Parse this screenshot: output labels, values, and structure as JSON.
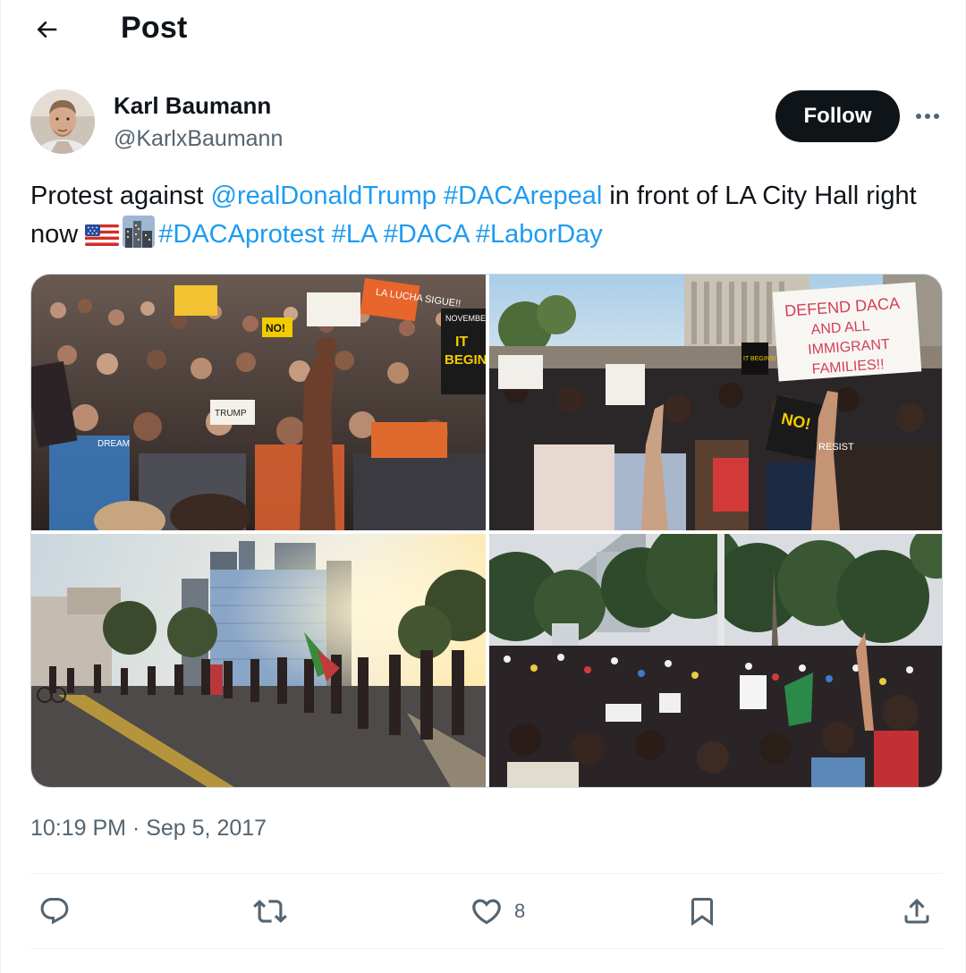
{
  "header": {
    "title": "Post",
    "back_icon": "arrow-left-icon"
  },
  "author": {
    "name": "Karl Baumann",
    "handle": "@KarlxBaumann",
    "follow_label": "Follow"
  },
  "tweet": {
    "segments": [
      {
        "text": "Protest against ",
        "type": "text"
      },
      {
        "text": "@realDonaldTrump",
        "type": "link"
      },
      {
        "text": " ",
        "type": "text"
      },
      {
        "text": "#DACArepeal",
        "type": "link"
      },
      {
        "text": " in front of LA City Hall right now ",
        "type": "text"
      },
      {
        "text": "#DACAprotest",
        "type": "link"
      },
      {
        "text": " ",
        "type": "text"
      },
      {
        "text": "#LA",
        "type": "link"
      },
      {
        "text": " ",
        "type": "text"
      },
      {
        "text": "#DACA",
        "type": "link"
      },
      {
        "text": " ",
        "type": "text"
      },
      {
        "text": "#LaborDay",
        "type": "link"
      }
    ],
    "emojis": [
      "us-flag-emoji",
      "cityscape-emoji"
    ],
    "link_color": "#1d9bf0"
  },
  "photos": {
    "p1": {
      "signs": [
        "LA LUCHA SIGUE!!",
        "NOVEMBER",
        "IT",
        "BEGIN",
        "NO!",
        "TRUMP",
        "DREAM"
      ]
    },
    "p2": {
      "signs": [
        "DEFEND DACA",
        "AND ALL",
        "IMMIGRANT",
        "FAMILIES!!",
        "NO!",
        "IT BEGINS!",
        "RESIST"
      ]
    },
    "p3": {},
    "p4": {}
  },
  "timestamp": "10:19 PM · Sep 5, 2017",
  "actions": {
    "reply_icon": "reply-icon",
    "repost_icon": "repost-icon",
    "like_icon": "heart-icon",
    "like_count": "8",
    "bookmark_icon": "bookmark-icon",
    "share_icon": "share-icon"
  },
  "colors": {
    "text": "#0f1419",
    "secondary": "#536471",
    "accent": "#1d9bf0",
    "button": "#0f1419"
  }
}
